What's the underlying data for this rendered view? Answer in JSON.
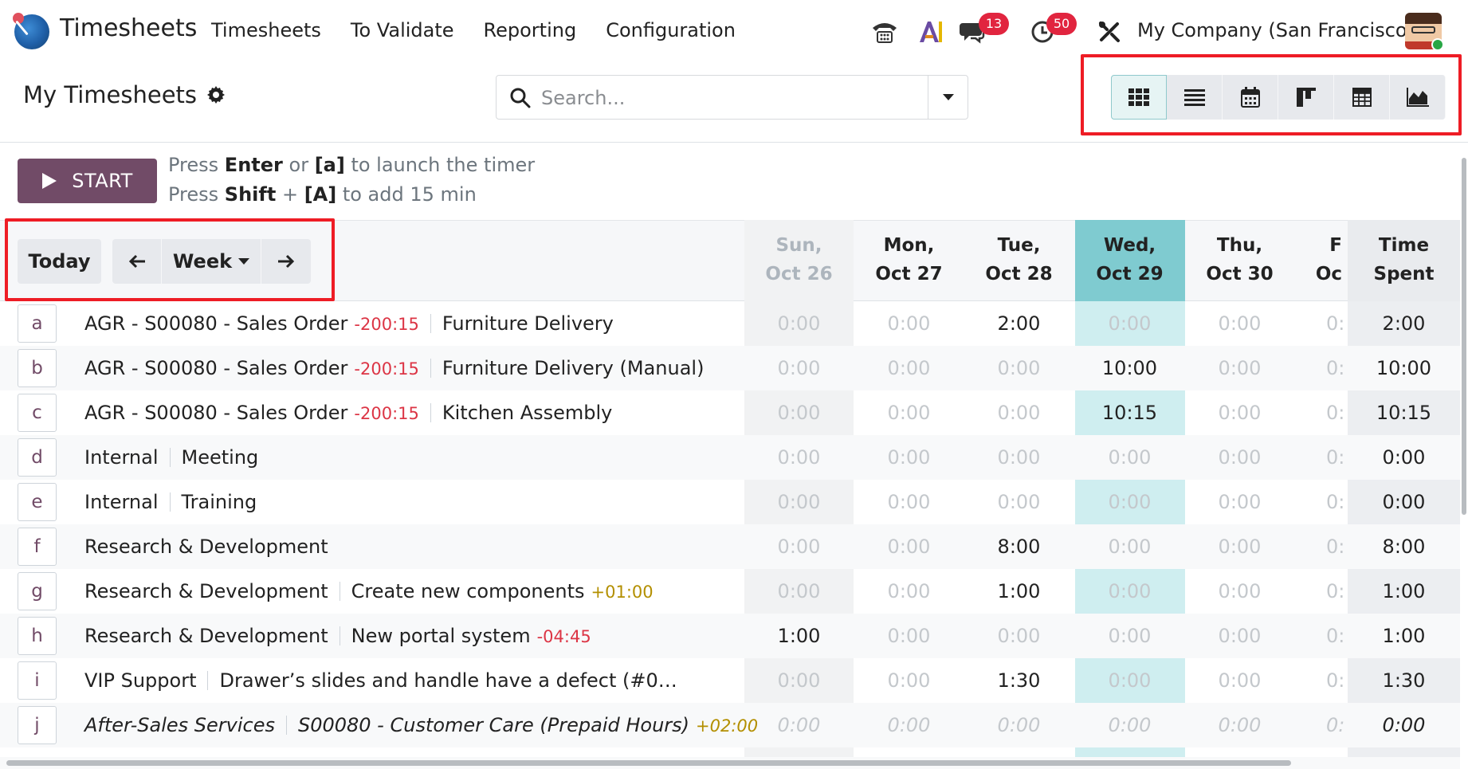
{
  "app": {
    "name": "Timesheets"
  },
  "menu": [
    "Timesheets",
    "To Validate",
    "Reporting",
    "Configuration"
  ],
  "systray": {
    "messages_count": "13",
    "activities_count": "50",
    "company": "My Company (San Francisco)"
  },
  "control": {
    "title": "My Timesheets",
    "search_placeholder": "Search..."
  },
  "views": [
    "grid",
    "list",
    "calendar",
    "kanban",
    "pivot",
    "graph"
  ],
  "timer": {
    "start_label": "START",
    "hint1": [
      "Press ",
      "Enter",
      " or ",
      "[a]",
      " to launch the timer"
    ],
    "hint2": [
      "Press ",
      "Shift",
      " + ",
      "[A]",
      " to add 15 min"
    ]
  },
  "grid_nav": {
    "today": "Today",
    "range": "Week"
  },
  "columns": [
    {
      "l1": "Sun,",
      "l2": "Oct 26"
    },
    {
      "l1": "Mon,",
      "l2": "Oct 27"
    },
    {
      "l1": "Tue,",
      "l2": "Oct 28"
    },
    {
      "l1": "Wed,",
      "l2": "Oct 29"
    },
    {
      "l1": "Thu,",
      "l2": "Oct 30"
    },
    {
      "l1": "F",
      "l2": "Oc"
    }
  ],
  "total_col": {
    "l1": "Time",
    "l2": "Spent"
  },
  "rows": [
    {
      "key": "a",
      "project": "AGR - S00080 - Sales Order",
      "remaining": "-200:15",
      "task": "Furniture Delivery",
      "values": [
        "0:00",
        "0:00",
        "2:00",
        "0:00",
        "0:00",
        "0:"
      ],
      "total": "2:00"
    },
    {
      "key": "b",
      "project": "AGR - S00080 - Sales Order",
      "remaining": "-200:15",
      "task": "Furniture Delivery (Manual)",
      "values": [
        "0:00",
        "0:00",
        "0:00",
        "10:00",
        "0:00",
        "0:"
      ],
      "total": "10:00"
    },
    {
      "key": "c",
      "project": "AGR - S00080 - Sales Order",
      "remaining": "-200:15",
      "task": "Kitchen Assembly",
      "values": [
        "0:00",
        "0:00",
        "0:00",
        "10:15",
        "0:00",
        "0:"
      ],
      "total": "10:15"
    },
    {
      "key": "d",
      "project": "Internal",
      "remaining": "",
      "task": "Meeting",
      "values": [
        "0:00",
        "0:00",
        "0:00",
        "0:00",
        "0:00",
        "0:"
      ],
      "total": "0:00"
    },
    {
      "key": "e",
      "project": "Internal",
      "remaining": "",
      "task": "Training",
      "values": [
        "0:00",
        "0:00",
        "0:00",
        "0:00",
        "0:00",
        "0:"
      ],
      "total": "0:00"
    },
    {
      "key": "f",
      "project": "Research & Development",
      "remaining": "",
      "task": "",
      "values": [
        "0:00",
        "0:00",
        "8:00",
        "0:00",
        "0:00",
        "0:"
      ],
      "total": "8:00"
    },
    {
      "key": "g",
      "project": "Research & Development",
      "remaining": "",
      "task": "Create new components",
      "task_remaining": "+01:00",
      "values": [
        "0:00",
        "0:00",
        "1:00",
        "0:00",
        "0:00",
        "0:"
      ],
      "total": "1:00"
    },
    {
      "key": "h",
      "project": "Research & Development",
      "remaining": "",
      "task": "New portal system",
      "task_remaining": "-04:45",
      "values": [
        "1:00",
        "0:00",
        "0:00",
        "0:00",
        "0:00",
        "0:"
      ],
      "total": "1:00"
    },
    {
      "key": "i",
      "project": "VIP Support",
      "remaining": "",
      "task": "Drawer’s slides and handle have a defect (#0…",
      "values": [
        "0:00",
        "0:00",
        "1:30",
        "0:00",
        "0:00",
        "0:"
      ],
      "total": "1:30"
    },
    {
      "key": "j",
      "project": "After-Sales Services",
      "remaining": "",
      "task": "S00080 - Customer Care (Prepaid Hours)",
      "task_remaining": "+02:00",
      "italic": true,
      "values": [
        "0:00",
        "0:00",
        "0:00",
        "0:00",
        "0:00",
        "0:"
      ],
      "total": "0:00"
    }
  ],
  "colors": {
    "brand": "#714b67",
    "today": "#7fcbd0",
    "highlight": "#ee1c25",
    "negative": "#dc3545",
    "positive": "#b38f00"
  }
}
